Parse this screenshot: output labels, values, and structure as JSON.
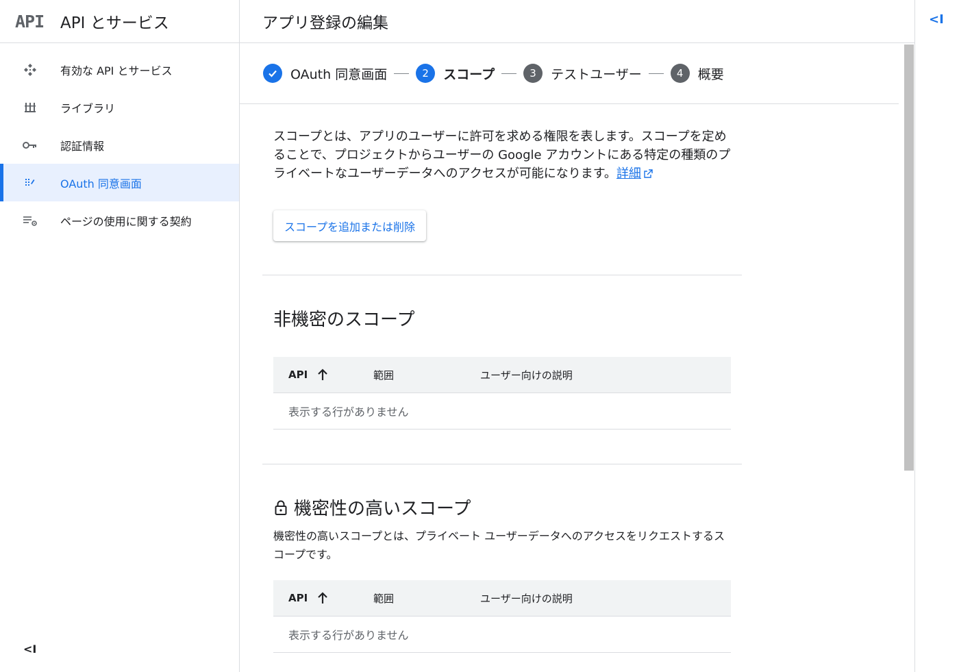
{
  "sidebar": {
    "logo": "API",
    "title": "API とサービス",
    "items": [
      {
        "label": "有効な API とサービス",
        "icon": "api-diamond-icon"
      },
      {
        "label": "ライブラリ",
        "icon": "library-icon"
      },
      {
        "label": "認証情報",
        "icon": "key-icon"
      },
      {
        "label": "OAuth 同意画面",
        "icon": "consent-grid-icon",
        "active": true
      },
      {
        "label": "ページの使用に関する契約",
        "icon": "settings-list-icon"
      }
    ],
    "collapse_label": "<I"
  },
  "header": {
    "title": "アプリ登録の編集"
  },
  "stepper": {
    "steps": [
      {
        "number": "1",
        "label": "OAuth 同意画面",
        "state": "done"
      },
      {
        "number": "2",
        "label": "スコープ",
        "state": "current"
      },
      {
        "number": "3",
        "label": "テストユーザー",
        "state": "pending"
      },
      {
        "number": "4",
        "label": "概要",
        "state": "pending"
      }
    ]
  },
  "content": {
    "intro_text": "スコープとは、アプリのユーザーに許可を求める権限を表します。スコープを定めることで、プロジェクトからユーザーの Google アカウントにある特定の種類のプライベートなユーザーデータへのアクセスが可能になります。",
    "learn_more": "詳細",
    "add_scope_button": "スコープを追加または削除",
    "non_sensitive": {
      "title": "非機密のスコープ",
      "columns": [
        "API",
        "範囲",
        "ユーザー向けの説明"
      ],
      "empty": "表示する行がありません"
    },
    "sensitive": {
      "title": "機密性の高いスコープ",
      "description": "機密性の高いスコープとは、プライベート ユーザーデータへのアクセスをリクエストするスコープです。",
      "columns": [
        "API",
        "範囲",
        "ユーザー向けの説明"
      ],
      "empty": "表示する行がありません"
    }
  },
  "right_rail": {
    "toggle_label": "<I"
  },
  "colors": {
    "accent": "#1a73e8",
    "active_bg": "#e8f0fe",
    "table_header_bg": "#f1f3f4",
    "divider": "#dadce0"
  }
}
